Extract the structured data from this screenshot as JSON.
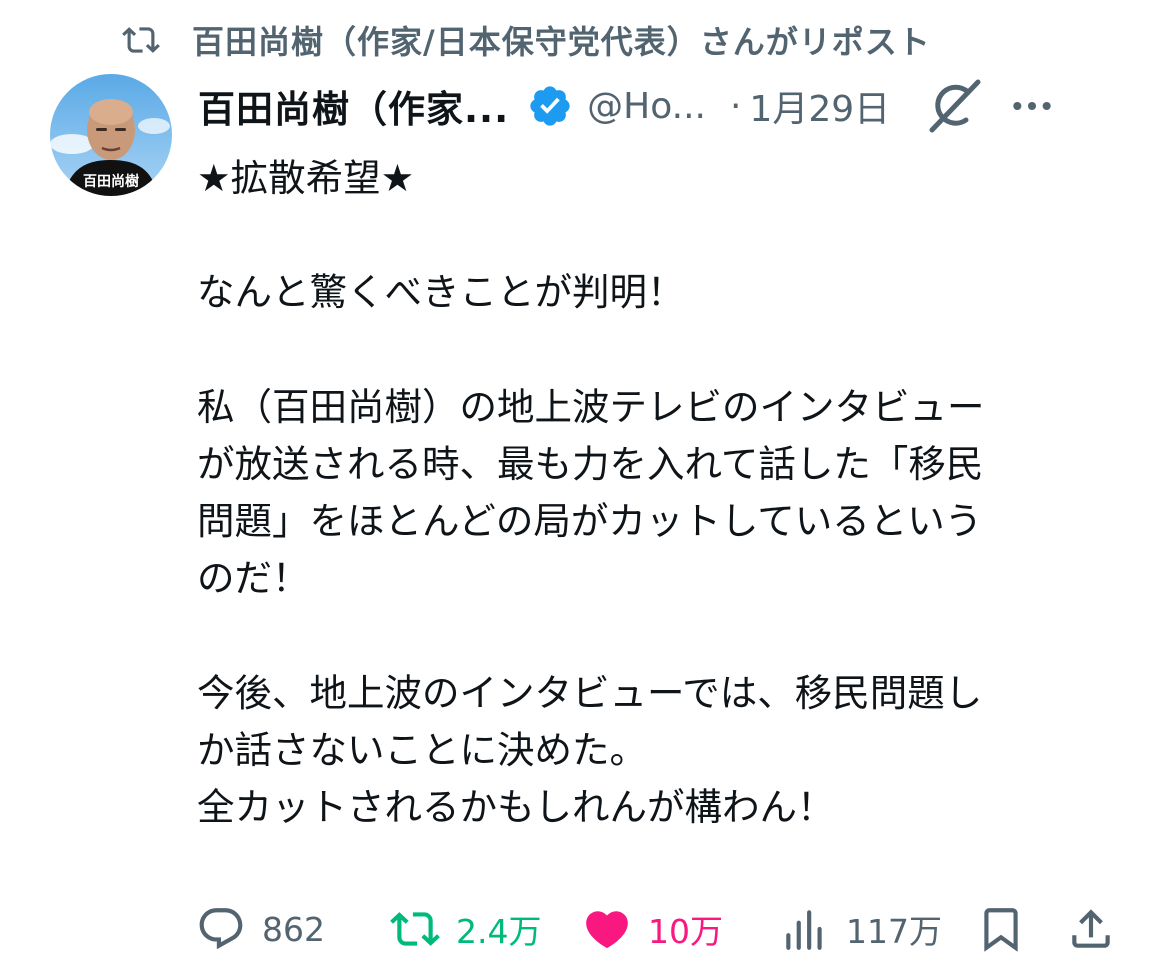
{
  "repost_banner": {
    "icon": "repost-icon",
    "text": "百田尚樹（作家/日本保守党代表）さんがリポスト"
  },
  "tweet": {
    "author": {
      "display_name": "百田尚樹（作家...",
      "verified": true,
      "handle": "@Ho...",
      "avatar_caption": "百田尚樹"
    },
    "separator": "·",
    "date": "1月29日",
    "body": {
      "headline": "★拡散希望★",
      "p1": "なんと驚くべきことが判明！",
      "p2": [
        "私（百田尚樹）の地上波テレビのインタビュー",
        "が放送される時、最も力を入れて話した「移民",
        "問題」をほとんどの局がカットしているという",
        "のだ！"
      ],
      "p3": [
        "今後、地上波のインタビューでは、移民問題し",
        "か話さないことに決めた。",
        "全カットされるかもしれんが構わん！"
      ]
    },
    "stats": {
      "replies": "862",
      "reposts": "2.4万",
      "likes": "10万",
      "views": "117万"
    }
  },
  "colors": {
    "text": "#0f1419",
    "muted": "#536471",
    "verified": "#1d9bf0",
    "repost_active": "#00ba7c",
    "like_active": "#f91880"
  }
}
